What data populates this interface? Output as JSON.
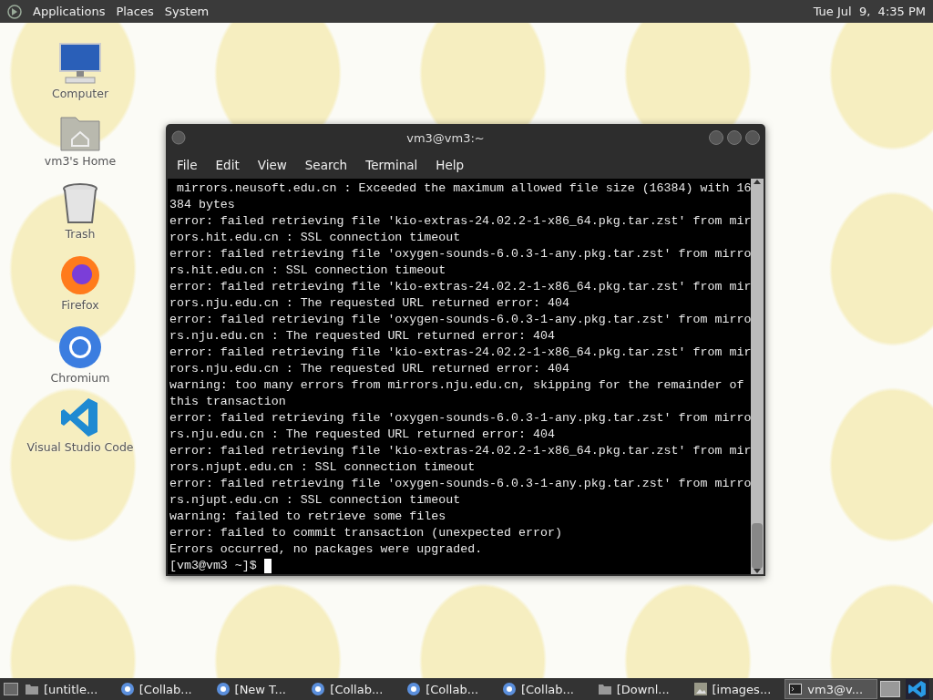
{
  "top_panel": {
    "menus": [
      "Applications",
      "Places",
      "System"
    ],
    "clock": "Tue Jul  9,  4:35 PM"
  },
  "desktop_icons": [
    {
      "kind": "computer",
      "label": "Computer"
    },
    {
      "kind": "home",
      "label": "vm3's Home"
    },
    {
      "kind": "trash",
      "label": "Trash"
    },
    {
      "kind": "firefox",
      "label": "Firefox"
    },
    {
      "kind": "chromium",
      "label": "Chromium"
    },
    {
      "kind": "vscode",
      "label": "Visual Studio Code"
    }
  ],
  "terminal": {
    "title": "vm3@vm3:~",
    "menu": [
      "File",
      "Edit",
      "View",
      "Search",
      "Terminal",
      "Help"
    ],
    "lines": [
      " mirrors.neusoft.edu.cn : Exceeded the maximum allowed file size (16384) with 16",
      "384 bytes",
      "error: failed retrieving file 'kio-extras-24.02.2-1-x86_64.pkg.tar.zst' from mir",
      "rors.hit.edu.cn : SSL connection timeout",
      "error: failed retrieving file 'oxygen-sounds-6.0.3-1-any.pkg.tar.zst' from mirro",
      "rs.hit.edu.cn : SSL connection timeout",
      "error: failed retrieving file 'kio-extras-24.02.2-1-x86_64.pkg.tar.zst' from mir",
      "rors.nju.edu.cn : The requested URL returned error: 404",
      "error: failed retrieving file 'oxygen-sounds-6.0.3-1-any.pkg.tar.zst' from mirro",
      "rs.nju.edu.cn : The requested URL returned error: 404",
      "error: failed retrieving file 'kio-extras-24.02.2-1-x86_64.pkg.tar.zst' from mir",
      "rors.nju.edu.cn : The requested URL returned error: 404",
      "warning: too many errors from mirrors.nju.edu.cn, skipping for the remainder of",
      "this transaction",
      "error: failed retrieving file 'oxygen-sounds-6.0.3-1-any.pkg.tar.zst' from mirro",
      "rs.nju.edu.cn : The requested URL returned error: 404",
      "error: failed retrieving file 'kio-extras-24.02.2-1-x86_64.pkg.tar.zst' from mir",
      "rors.njupt.edu.cn : SSL connection timeout",
      "error: failed retrieving file 'oxygen-sounds-6.0.3-1-any.pkg.tar.zst' from mirro",
      "rs.njupt.edu.cn : SSL connection timeout",
      "warning: failed to retrieve some files",
      "error: failed to commit transaction (unexpected error)",
      "Errors occurred, no packages were upgraded."
    ],
    "prompt": "[vm3@vm3 ~]$"
  },
  "taskbar": {
    "items": [
      {
        "kind": "folder",
        "label": "[untitle...",
        "selected": false
      },
      {
        "kind": "chromium",
        "label": "[Collab...",
        "selected": false
      },
      {
        "kind": "chromium",
        "label": "[New T...",
        "selected": false
      },
      {
        "kind": "chromium",
        "label": "[Collab...",
        "selected": false
      },
      {
        "kind": "chromium",
        "label": "[Collab...",
        "selected": false
      },
      {
        "kind": "chromium",
        "label": "[Collab...",
        "selected": false
      },
      {
        "kind": "folder",
        "label": "[Downl...",
        "selected": false
      },
      {
        "kind": "image",
        "label": "[images...",
        "selected": false
      },
      {
        "kind": "terminal",
        "label": "vm3@v...",
        "selected": true
      }
    ]
  }
}
